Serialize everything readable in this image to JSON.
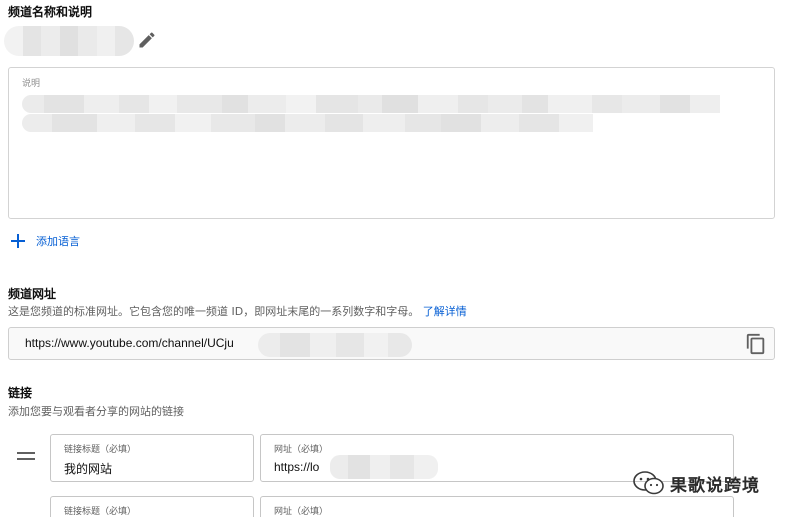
{
  "channel_name": {
    "title": "频道名称和说明",
    "edit_icon": "pencil-icon"
  },
  "description": {
    "label": "说明"
  },
  "add_language": {
    "label": "添加语言",
    "icon": "plus-icon",
    "color": "#065fd4"
  },
  "channel_url": {
    "title": "频道网址",
    "desc": "这是您频道的标准网址。它包含您的唯一频道 ID，即网址末尾的一系列数字和字母。",
    "learn_more": "了解详情",
    "value": "https://www.youtube.com/channel/UCju",
    "copy_icon": "copy-icon"
  },
  "links": {
    "title": "链接",
    "desc": "添加您要与观看者分享的网站的链接",
    "drag_icon": "drag-handle-icon",
    "rows": [
      {
        "title_label": "链接标题（必填）",
        "title_value": "我的网站",
        "url_label": "网址（必填）",
        "url_value": "https://lo"
      },
      {
        "title_label": "链接标题（必填）",
        "title_value": "",
        "url_label": "网址（必填）",
        "url_value": ""
      }
    ]
  },
  "watermark": {
    "text": "果歌说跨境",
    "icon": "wechat-icon"
  }
}
